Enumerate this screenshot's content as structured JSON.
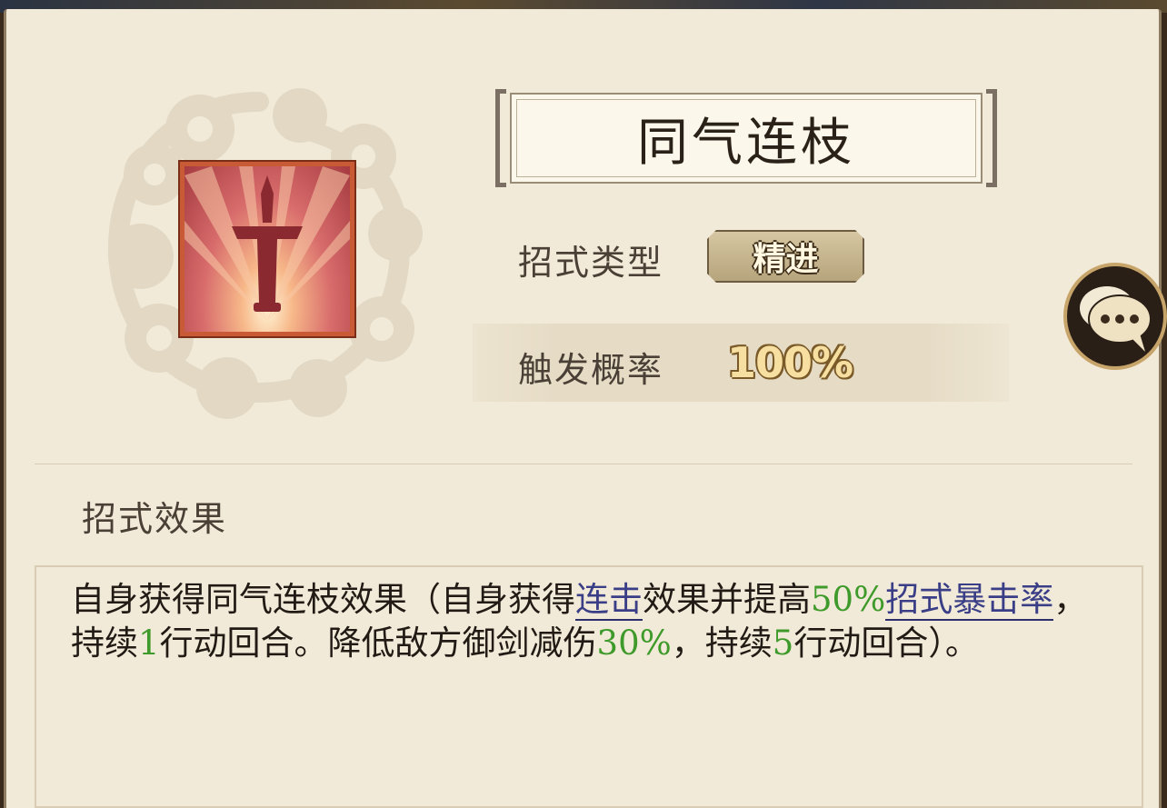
{
  "skill": {
    "name": "同气连枝",
    "icon": "sword-icon",
    "type_label": "招式类型",
    "type_value": "精进",
    "trigger_label": "触发概率",
    "trigger_value": "100%"
  },
  "effect": {
    "section_title": "招式效果",
    "segments": {
      "s1": "自身获得同气连枝效果（自身获得",
      "k1": "连击",
      "s2": "效果并提高",
      "n1": "50%",
      "k2": "招式暴击率",
      "s3": "，持续",
      "n2": "1",
      "s4": "行动回合。降低敌方御剑减伤",
      "n3": "30%",
      "s5": "，持续",
      "n4": "5",
      "s6": "行动回合）。"
    }
  },
  "chat_button": {
    "icon": "chat-bubble-icon"
  },
  "colors": {
    "panel_bg": "#f2ead8",
    "keyword": "#3a3e86",
    "number": "#3e9a2a",
    "icon_frame": "#c85a36"
  }
}
